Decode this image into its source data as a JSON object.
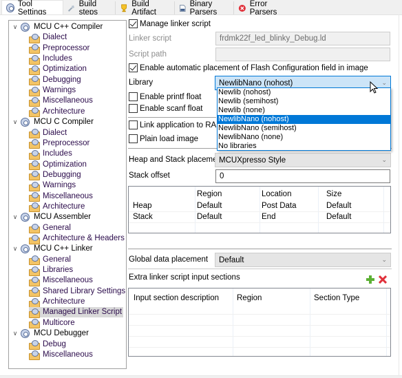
{
  "tabs": [
    {
      "label": "Tool Settings",
      "icon": "gear-icon",
      "active": true
    },
    {
      "label": "Build steps",
      "icon": "hammer-icon",
      "active": false
    },
    {
      "label": "Build Artifact",
      "icon": "trophy-icon",
      "active": false
    },
    {
      "label": "Binary Parsers",
      "icon": "binary-file-icon",
      "active": false
    },
    {
      "label": "Error Parsers",
      "icon": "error-icon",
      "active": false
    }
  ],
  "tree": [
    {
      "type": "cat",
      "label": "MCU C++ Compiler"
    },
    {
      "type": "leaf",
      "label": "Dialect"
    },
    {
      "type": "leaf",
      "label": "Preprocessor"
    },
    {
      "type": "leaf",
      "label": "Includes"
    },
    {
      "type": "leaf",
      "label": "Optimization"
    },
    {
      "type": "leaf",
      "label": "Debugging"
    },
    {
      "type": "leaf",
      "label": "Warnings"
    },
    {
      "type": "leaf",
      "label": "Miscellaneous"
    },
    {
      "type": "leaf",
      "label": "Architecture"
    },
    {
      "type": "cat",
      "label": "MCU C Compiler"
    },
    {
      "type": "leaf",
      "label": "Dialect"
    },
    {
      "type": "leaf",
      "label": "Preprocessor"
    },
    {
      "type": "leaf",
      "label": "Includes"
    },
    {
      "type": "leaf",
      "label": "Optimization"
    },
    {
      "type": "leaf",
      "label": "Debugging"
    },
    {
      "type": "leaf",
      "label": "Warnings"
    },
    {
      "type": "leaf",
      "label": "Miscellaneous"
    },
    {
      "type": "leaf",
      "label": "Architecture"
    },
    {
      "type": "cat",
      "label": "MCU Assembler"
    },
    {
      "type": "leaf",
      "label": "General"
    },
    {
      "type": "leaf",
      "label": "Architecture & Headers"
    },
    {
      "type": "cat",
      "label": "MCU C++ Linker"
    },
    {
      "type": "leaf",
      "label": "General"
    },
    {
      "type": "leaf",
      "label": "Libraries"
    },
    {
      "type": "leaf",
      "label": "Miscellaneous"
    },
    {
      "type": "leaf",
      "label": "Shared Library Settings"
    },
    {
      "type": "leaf",
      "label": "Architecture"
    },
    {
      "type": "leaf",
      "label": "Managed Linker Script",
      "selected": true
    },
    {
      "type": "leaf",
      "label": "Multicore"
    },
    {
      "type": "cat",
      "label": "MCU Debugger"
    },
    {
      "type": "leaf",
      "label": "Debug"
    },
    {
      "type": "leaf",
      "label": "Miscellaneous"
    }
  ],
  "settings": {
    "manage_linker_script": {
      "label": "Manage linker script",
      "checked": true
    },
    "linker_script": {
      "label": "Linker script",
      "value": "frdmk22f_led_blinky_Debug.ld"
    },
    "script_path": {
      "label": "Script path",
      "value": ""
    },
    "flash_config": {
      "label": "Enable automatic placement of Flash Configuration field in image",
      "checked": true
    },
    "library": {
      "label": "Library",
      "value": "NewlibNano (nohost)",
      "options": [
        "Newlib (nohost)",
        "Newlib (semihost)",
        "Newlib (none)",
        "NewlibNano (nohost)",
        "NewlibNano (semihost)",
        "NewlibNano (none)",
        "No libraries"
      ],
      "selected_index": 3
    },
    "printf_float": {
      "label": "Enable printf float",
      "checked": false
    },
    "scanf_float": {
      "label": "Enable scanf float",
      "checked": false
    },
    "link_to_ram": {
      "label": "Link application to RAM",
      "checked": false
    },
    "plain_load_image": {
      "label": "Plain load image",
      "checked": false
    },
    "heap_stack_placement": {
      "label": "Heap and Stack placement",
      "value": "MCUXpresso Style"
    },
    "stack_offset": {
      "label": "Stack offset",
      "value": "0"
    },
    "heap_stack_table": {
      "headers": [
        "",
        "Region",
        "Location",
        "Size"
      ],
      "rows": [
        [
          "Heap",
          "Default",
          "Post Data",
          "Default"
        ],
        [
          "Stack",
          "Default",
          "End",
          "Default"
        ]
      ]
    },
    "global_data_placement": {
      "label": "Global data placement",
      "value": "Default"
    },
    "extra_sections": {
      "label": "Extra linker script input sections",
      "add_icon": "add-icon",
      "remove_icon": "remove-icon",
      "headers": [
        "Input section description",
        "Region",
        "Section Type"
      ],
      "rows": []
    }
  }
}
